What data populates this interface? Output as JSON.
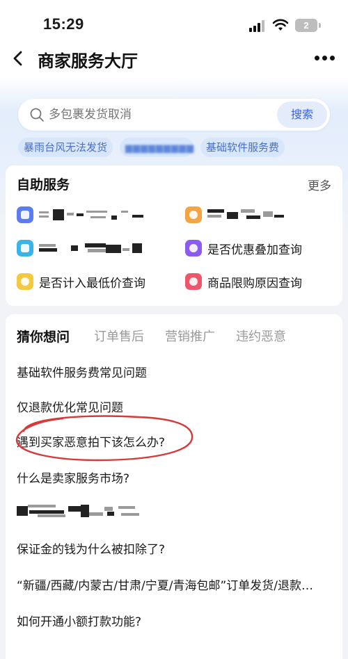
{
  "status_bar": {
    "time": "15:29",
    "battery": "2"
  },
  "nav": {
    "title": "商家服务大厅"
  },
  "search": {
    "placeholder": "多包裹发货取消",
    "button_label": "搜索"
  },
  "hot_tags": [
    "暴雨台风无法发货",
    "",
    "基础软件服务费"
  ],
  "self_service": {
    "title": "自助服务",
    "more_label": "更多",
    "items": [
      {
        "label": "",
        "icon": "document-icon",
        "color": "#5b7cf0"
      },
      {
        "label": "",
        "icon": "mail-icon",
        "color": "#f5a442"
      },
      {
        "label": "",
        "icon": "file-icon",
        "color": "#39b3e8"
      },
      {
        "label": "是否优惠叠加查询",
        "icon": "coupon-icon",
        "color": "#8c5cf0"
      },
      {
        "label": "是否计入最低价查询",
        "icon": "price-icon",
        "color": "#f5c842"
      },
      {
        "label": "商品限购原因查询",
        "icon": "limit-icon",
        "color": "#f0566a"
      }
    ]
  },
  "guess": {
    "tabs": [
      "猜你想问",
      "订单售后",
      "营销推广",
      "违约恶意"
    ],
    "active_tab": 0,
    "questions": [
      "基础软件服务费常见问题",
      "仅退款优化常见问题",
      "遇到买家恶意拍下该怎么办?",
      "什么是卖家服务市场?",
      "",
      "保证金的钱为什么被扣除了?",
      "“新疆/西藏/内蒙古/甘肃/宁夏/青海包邮”订单发货/退款…",
      "如何开通小额打款功能?"
    ]
  },
  "colors": {
    "accent": "#3a63e0",
    "annotation": "#d63a3a"
  }
}
